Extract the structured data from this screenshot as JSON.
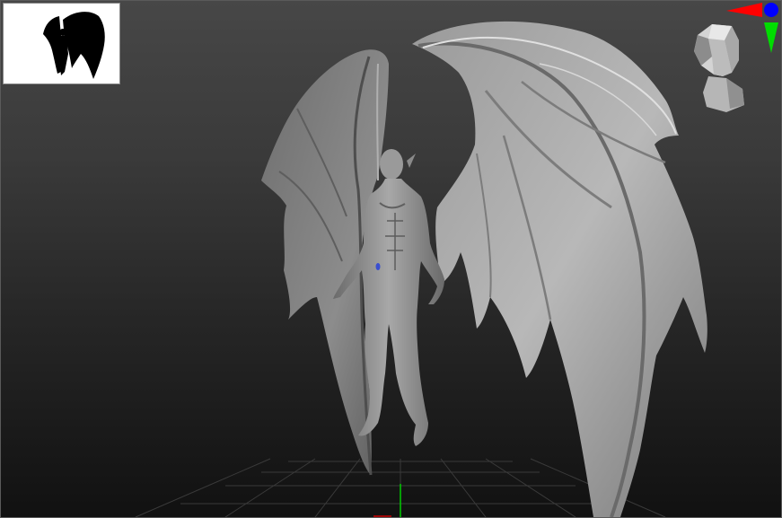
{
  "viewport": {
    "name": "3d-sculpting-viewport",
    "background_top": "#474747",
    "background_bottom": "#111111",
    "mesh_color": "#8f8f8f",
    "mesh_highlight": "#c9c9c9",
    "mesh_shadow": "#4a4a4a",
    "floor_grid": true
  },
  "thumbnail": {
    "name": "silhouette-preview",
    "background": "#ffffff",
    "silhouette_color": "#000000"
  },
  "axis_gizmo": {
    "x_color": "#ff0000",
    "y_color": "#00dd00",
    "z_color": "#0000ff"
  },
  "navigation_head": {
    "name": "head-navigation-cube",
    "color": "#c8c8c8"
  }
}
